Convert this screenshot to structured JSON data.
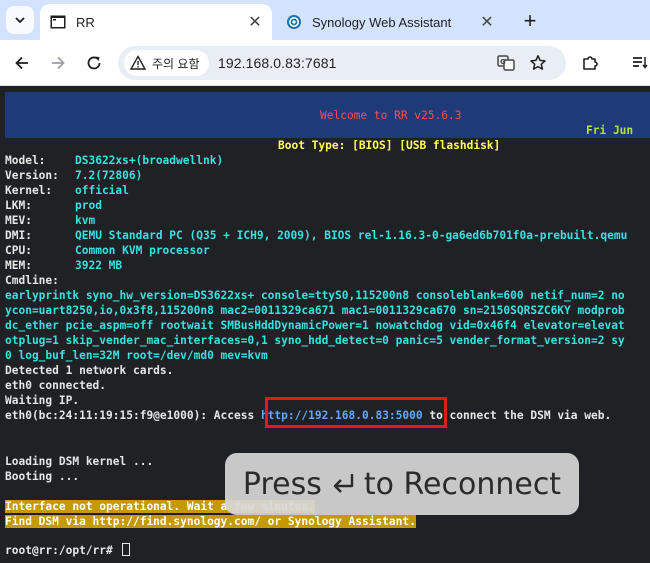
{
  "browser": {
    "tabs": [
      {
        "title": "RR",
        "active": true
      },
      {
        "title": "Synology Web Assistant",
        "active": false
      }
    ],
    "security_chip": "주의 요함",
    "url": "192.168.0.83:7681"
  },
  "terminal": {
    "welcome": "Welcome to RR v25.6.3",
    "date": "Fri Jun",
    "boot_line": "Boot Type: [BIOS] [USB flashdisk]",
    "info": [
      {
        "label": "Model:",
        "value": "DS3622xs+(broadwellnk)"
      },
      {
        "label": "Version:",
        "value": "7.2(72806)"
      },
      {
        "label": "Kernel:",
        "value": "official"
      },
      {
        "label": "LKM:",
        "value": "prod"
      },
      {
        "label": "MEV:",
        "value": "kvm"
      },
      {
        "label": "DMI:",
        "value": "QEMU Standard PC (Q35 + ICH9, 2009), BIOS rel-1.16.3-0-ga6ed6b701f0a-prebuilt.qemu"
      },
      {
        "label": "CPU:",
        "value": "Common KVM processor"
      },
      {
        "label": "MEM:",
        "value": "3922 MB"
      },
      {
        "label": "Cmdline:",
        "value": ""
      }
    ],
    "cmdline": [
      "earlyprintk syno_hw_version=DS3622xs+ console=ttyS0,115200n8 consoleblank=600 netif_num=2 no",
      "ycon=uart8250,io,0x3f8,115200n8 mac2=0011329ca671 mac1=0011329ca670 sn=2150SQRSZC6KY modprob",
      "dc_ether pcie_aspm=off rootwait SMBusHddDynamicPower=1 nowatchdog vid=0x46f4 elevator=elevat",
      "otplug=1 skip_vender_mac_interfaces=0,1 syno_hdd_detect=0 panic=5 vender_format_version=2 sy",
      "0 log_buf_len=32M root=/dev/md0 mev=kvm"
    ],
    "net_lines": [
      "Detected 1 network cards.",
      "eth0 connected.",
      "Waiting IP."
    ],
    "access_prefix": "eth0(bc:24:11:19:15:f9@e1000): Access ",
    "access_url": "http://192.168.0.83:5000",
    "access_suffix": " to connect the DSM via web.",
    "loading": "Loading DSM kernel ...",
    "booting": "Booting ...",
    "warning_1": "Interface not operational. Wait a few minutes.",
    "warning_2": "Find DSM via http://find.synology.com/ or Synology Assistant.",
    "prompt": "root@rr:/opt/rr# "
  },
  "overlay": {
    "press": "Press",
    "reconnect": "to Reconnect"
  },
  "icons": [
    "chevron-down-icon",
    "terminal-icon",
    "globe-icon",
    "close-icon",
    "plus-icon",
    "back-icon",
    "forward-icon",
    "reload-icon",
    "warning-icon",
    "translate-icon",
    "star-icon",
    "extensions-icon",
    "reading-list-icon",
    "enter-key-icon"
  ],
  "colors": {
    "tab_strip": "#d3e3fd",
    "terminal_bg": "#202124",
    "header_bg": "#1f3a79",
    "welcome": "#ff4d4d",
    "boot_line": "#ffff55",
    "value_cyan": "#34e2e2",
    "highlight": "#c49a00",
    "link_box": "#e01b1b"
  }
}
